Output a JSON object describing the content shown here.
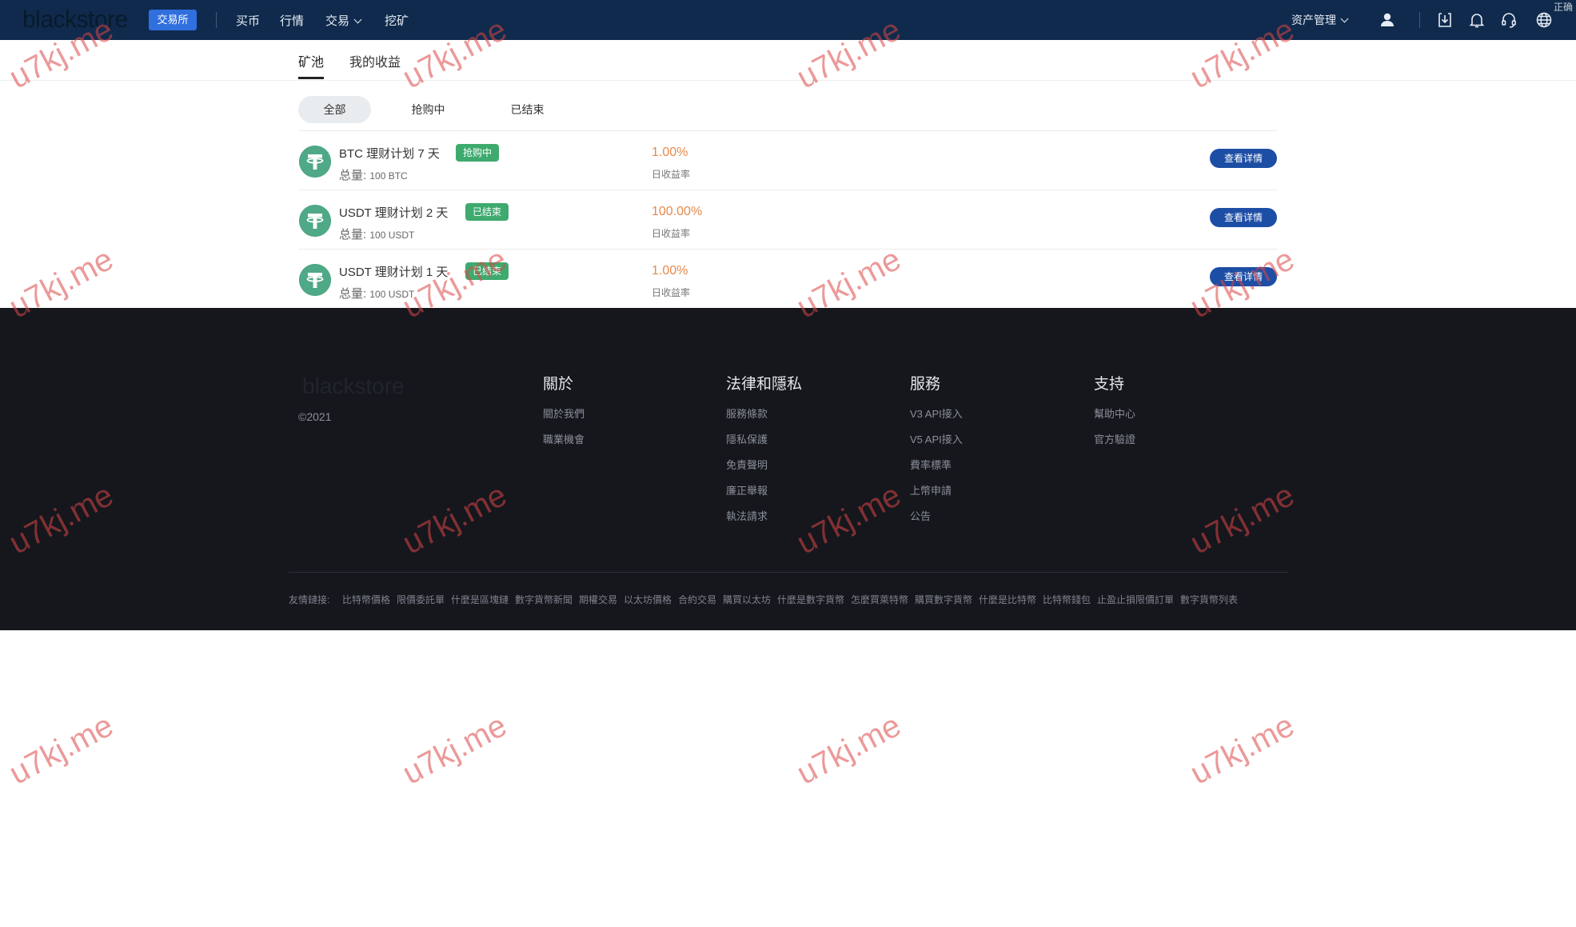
{
  "header": {
    "logo_text": "blackstore",
    "exchange_button": "交易所",
    "nav_items": [
      "买币",
      "行情",
      "交易",
      "挖矿"
    ],
    "asset_menu": "资产管理",
    "corner_text": "正确",
    "icons": [
      "user-icon",
      "download-icon",
      "bell-icon",
      "headset-icon",
      "globe-icon"
    ]
  },
  "tabs": [
    "矿池",
    "我的收益"
  ],
  "filters": [
    "全部",
    "抢购中",
    "已结束"
  ],
  "pools": [
    {
      "title": "BTC 理财计划  7 天",
      "badge": "抢购中",
      "total_label": "总量:",
      "total_amount": "100 BTC",
      "rate": "1.00%",
      "rate_label": "日收益率",
      "button": "查看详情"
    },
    {
      "title": "USDT 理财计划  2 天",
      "badge": "已结束",
      "total_label": "总量:",
      "total_amount": "100 USDT",
      "rate": "100.00%",
      "rate_label": "日收益率",
      "button": "查看详情"
    },
    {
      "title": "USDT 理财计划  1 天",
      "badge": "已结束",
      "total_label": "总量:",
      "total_amount": "100 USDT",
      "rate": "1.00%",
      "rate_label": "日收益率",
      "button": "查看详情"
    }
  ],
  "footer": {
    "logo_text": "blackstore",
    "copyright": "©2021",
    "columns": [
      {
        "title": "關於",
        "links": [
          "關於我們",
          "職業機會"
        ]
      },
      {
        "title": "法律和隱私",
        "links": [
          "服務條款",
          "隱私保護",
          "免責聲明",
          "廉正舉報",
          "執法請求"
        ]
      },
      {
        "title": "服務",
        "links": [
          "V3 API接入",
          "V5 API接入",
          "費率標準",
          "上幣申請",
          "公告"
        ]
      },
      {
        "title": "支持",
        "links": [
          "幫助中心",
          "官方驗證"
        ]
      }
    ],
    "friend_links_label": "友情鏈接:",
    "friend_links": [
      "比特幣價格",
      "限價委託單",
      "什麼是區塊鏈",
      "數字貨幣新聞",
      "期權交易",
      "以太坊價格",
      "合約交易",
      "購買以太坊",
      "什麼是數字貨幣",
      "怎麼買萊特幣",
      "購買數字貨幣",
      "什麼是比特幣",
      "比特幣錢包",
      "止盈止損限價訂單",
      "數字貨幣列表"
    ]
  },
  "watermark": "u7kj.me",
  "colors": {
    "nav_bg": "#0f2a4c",
    "accent_blue": "#2f6fde",
    "button_blue": "#1d4ea5",
    "badge_green": "#3eaa6e",
    "rate_orange": "#e6894b",
    "footer_bg": "#15171d"
  }
}
